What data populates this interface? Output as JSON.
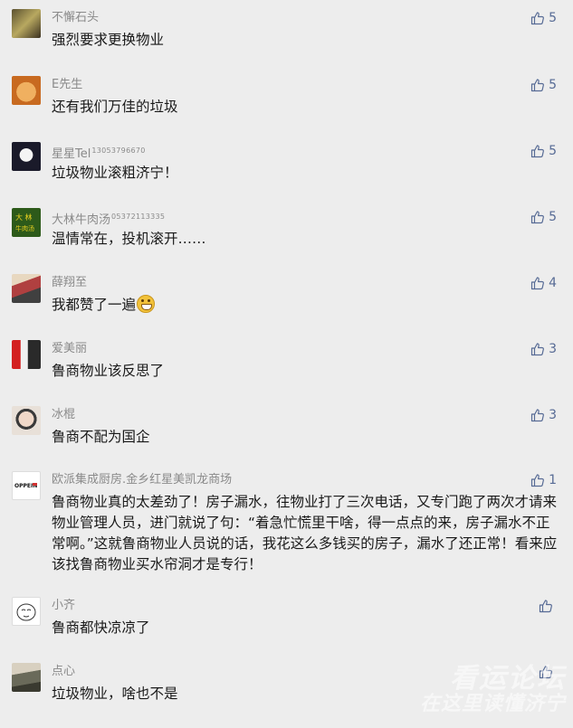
{
  "comments": [
    {
      "name": "不懈石头",
      "tel": "",
      "text": "强烈要求更换物业",
      "likes": "5",
      "avatar_color": "#8a7a3a"
    },
    {
      "name": "E先生",
      "tel": "",
      "text": "还有我们万佳的垃圾",
      "likes": "5",
      "avatar_color": "#d98a3c"
    },
    {
      "name": "星星Tel",
      "tel": "13053796670",
      "text": "垃圾物业滚粗济宁！",
      "likes": "5",
      "avatar_color": "#2a2a2a"
    },
    {
      "name": "大林牛肉汤",
      "tel": "05372113335",
      "text": "温情常在，投机滚开……",
      "likes": "5",
      "avatar_color": "#2d5a1a"
    },
    {
      "name": "薛翔至",
      "tel": "",
      "text": "我都赞了一遍",
      "likes": "4",
      "avatar_color": "#b04040"
    },
    {
      "name": "爱美丽",
      "tel": "",
      "text": "鲁商物业该反思了",
      "likes": "3",
      "avatar_color": "#d32020"
    },
    {
      "name": "冰棍",
      "tel": "",
      "text": "鲁商不配为国企",
      "likes": "3",
      "avatar_color": "#c9b8a8"
    },
    {
      "name": "欧派集成厨房.金乡红星美凯龙商场",
      "tel": "",
      "text": "鲁商物业真的太差劲了！房子漏水，往物业打了三次电话，又专门跑了两次才请来物业管理人员，进门就说了句：“着急忙慌里干啥，得一点点的来，房子漏水不正常啊。”这就鲁商物业人员说的话，我花这么多钱买的房子，漏水了还正常！看来应该找鲁商物业买水帘洞才是专行！",
      "likes": "1",
      "avatar_color": "#ffffff",
      "avatar_text": "OPPEIN"
    },
    {
      "name": "小齐",
      "tel": "",
      "text": "鲁商都快凉凉了",
      "likes": "",
      "avatar_color": "#ffffff"
    },
    {
      "name": "点心",
      "tel": "",
      "text": "垃圾物业，啥也不是",
      "likes": "",
      "avatar_color": "#6a6a5a"
    }
  ],
  "watermark": {
    "line1": "看运论坛",
    "line2": "在这里读懂济宁"
  }
}
